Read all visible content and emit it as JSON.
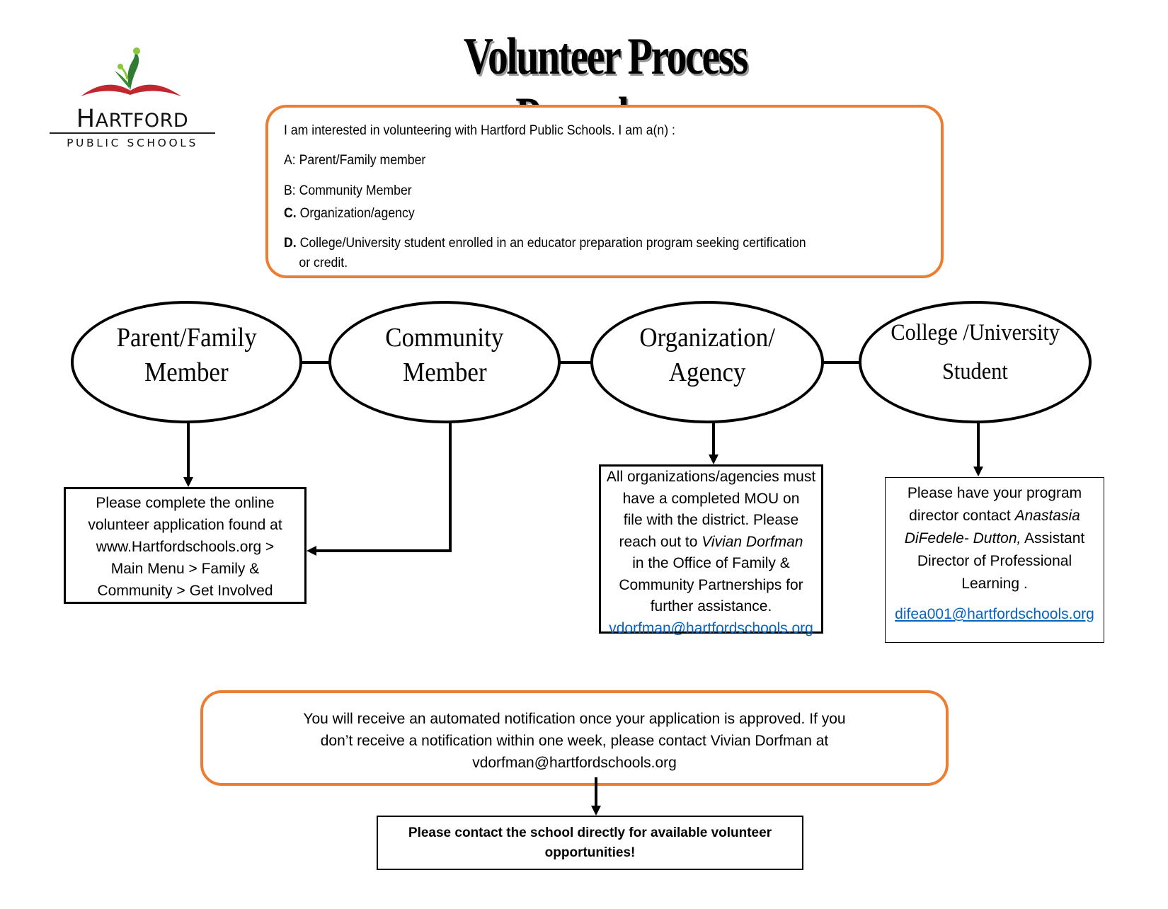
{
  "logo": {
    "name_initial": "H",
    "name_rest": "ARTFORD",
    "subtitle": "PUBLIC SCHOOLS",
    "colors": {
      "book_red": "#c1272d",
      "leaf_green": "#3a8a2e",
      "leaf_light": "#8cc63f"
    }
  },
  "title": "Volunteer Process Procedures",
  "intro": {
    "prompt": "I am interested in volunteering with Hartford Public Schools. I am a(n) :",
    "options": [
      {
        "marker": "A:",
        "text": "Parent/Family member",
        "marker_bold": false
      },
      {
        "marker": "B:",
        "text": "Community Member",
        "marker_bold": false
      },
      {
        "marker": "C.",
        "text": "Organization/agency",
        "marker_bold": true
      },
      {
        "marker": "D.",
        "text": "College/University student enrolled in an educator preparation program seeking certification",
        "continuation": "or credit.",
        "marker_bold": true
      }
    ]
  },
  "categories": [
    {
      "id": "parent",
      "line1": "Parent/Family",
      "line2": "Member"
    },
    {
      "id": "community",
      "line1": "Community",
      "line2": "Member"
    },
    {
      "id": "org",
      "line1": "Organization/",
      "line2": "Agency"
    },
    {
      "id": "college",
      "line1": "College /University",
      "line2": "Student"
    }
  ],
  "boxes": {
    "parent_community": {
      "lines": [
        "Please complete the online",
        "volunteer application found at",
        "www.Hartfordschools.org >",
        "Main Menu > Family &",
        "Community > Get Involved"
      ]
    },
    "org": {
      "line1": "All organizations/agencies must",
      "line2": "have a completed MOU on",
      "line3": "file with the district. Please",
      "line4_prefix": "reach out to ",
      "line4_name": "Vivian Dorfman",
      "line5": "in the Office of Family &",
      "line6": "Community Partnerships for",
      "line7": "further assistance.",
      "email": "vdorfman@hartfordschools.org"
    },
    "college": {
      "line1": "Please have your program",
      "line2_prefix": "director contact ",
      "line2_name": "Anastasia",
      "line3_name": "DiFedele- Dutton,",
      "line3_suffix": " Assistant",
      "line4": "Director of Professional",
      "line5": "Learning .",
      "email": "difea001@hartfordschools.org"
    }
  },
  "notice": {
    "line1": "You will receive an automated notification once your application is approved. If you",
    "line2": "don’t receive a notification within one week, please contact Vivian Dorfman at",
    "line3": "vdorfman@hartfordschools.org"
  },
  "final": {
    "line1": "Please contact the school directly for available volunteer",
    "line2": "opportunities!"
  },
  "colors": {
    "accent_orange": "#ed7d31",
    "link_blue": "#0563c1"
  }
}
